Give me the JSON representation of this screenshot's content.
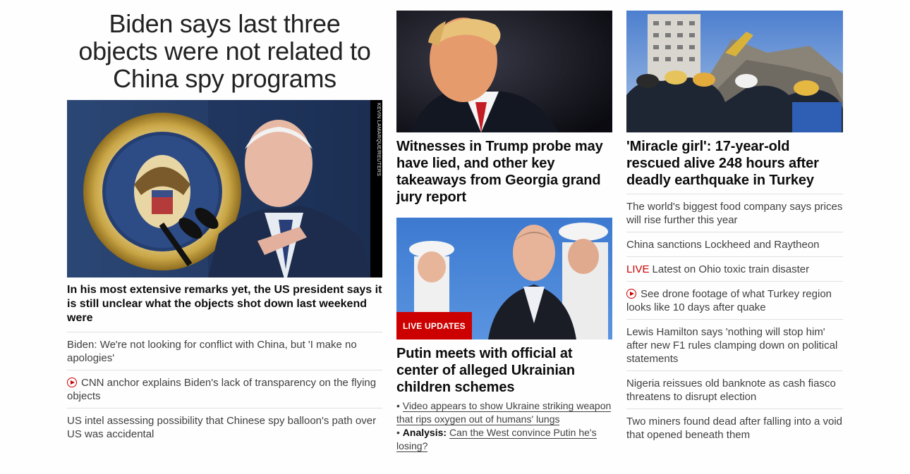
{
  "lead": {
    "headline": "Biden says last three objects were not related to China spy programs",
    "image_alt": "Joe Biden speaking at podium with presidential seal",
    "image_credit": "KEVIN LAMARQUE/REUTERS",
    "subheadline": "In his most extensive remarks yet, the US president says it is still unclear what the objects shot down last weekend were",
    "stories": [
      {
        "text": "Biden: We're not looking for conflict with China, but 'I make no apologies'",
        "video": false
      },
      {
        "text": "CNN anchor explains Biden's lack of transparency on the flying objects",
        "video": true
      },
      {
        "text": "US intel assessing possibility that Chinese spy balloon's path over US was accidental",
        "video": false
      }
    ]
  },
  "middle": {
    "card1": {
      "image_alt": "Donald Trump",
      "headline": "Witnesses in Trump probe may have lied, and other key takeaways from Georgia grand jury report"
    },
    "card2": {
      "image_alt": "Vladimir Putin with naval officers saluting",
      "badge": "LIVE UPDATES",
      "headline": "Putin meets with official at center of alleged Ukrainian children schemes",
      "bullets": [
        {
          "prefix": "",
          "text": "Video appears to show Ukraine striking weapon that rips oxygen out of humans' lungs"
        },
        {
          "prefix": "Analysis:",
          "text": "Can the West convince Putin he's losing?"
        }
      ]
    }
  },
  "right": {
    "image_alt": "Rescue workers at earthquake rubble in Turkey",
    "headline": "'Miracle girl': 17-year-old rescued alive 248 hours after deadly earthquake in Turkey",
    "stories": [
      {
        "text": "The world's biggest food company says prices will rise further this year",
        "live": false,
        "video": false
      },
      {
        "text": "China sanctions Lockheed and Raytheon",
        "live": false,
        "video": false
      },
      {
        "text": "Latest on Ohio toxic train disaster",
        "live": true,
        "live_label": "LIVE",
        "video": false
      },
      {
        "text": "See drone footage of what Turkey region looks like 10 days after quake",
        "live": false,
        "video": true
      },
      {
        "text": "Lewis Hamilton says 'nothing will stop him' after new F1 rules clamping down on political statements",
        "live": false,
        "video": false
      },
      {
        "text": "Nigeria reissues old banknote as cash fiasco threatens to disrupt election",
        "live": false,
        "video": false
      },
      {
        "text": "Two miners found dead after falling into a void that opened beneath them",
        "live": false,
        "video": false
      }
    ]
  },
  "colors": {
    "accent": "#cc0000",
    "text": "#0c0c0c",
    "muted": "#404040",
    "divider": "#e0e0e0"
  }
}
